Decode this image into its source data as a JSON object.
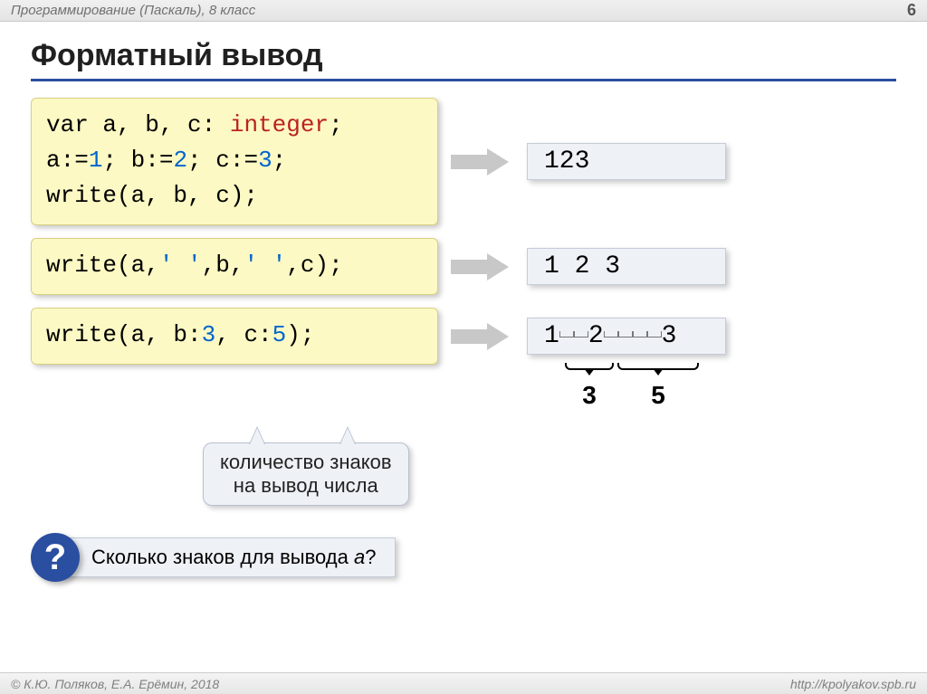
{
  "header": {
    "course": "Программирование (Паскаль), 8 класс",
    "pageNumber": "6"
  },
  "title": "Форматный вывод",
  "block1": {
    "line1": {
      "pre": "var a, b, c: ",
      "type": "integer",
      "post": ";"
    },
    "line2": {
      "p1": "a:=",
      "n1": "1",
      "p2": "; b:=",
      "n2": "2",
      "p3": "; c:=",
      "n3": "3",
      "p4": ";"
    },
    "line3": "write(a, b, c);",
    "output": "123"
  },
  "block2": {
    "code": {
      "p1": "write(a,",
      "s1": "' '",
      "p2": ",b,",
      "s2": "' '",
      "p3": ",c);"
    },
    "output": "1 2 3"
  },
  "block3": {
    "code": {
      "p1": "write(a, b:",
      "n1": "3",
      "p2": ", c:",
      "n2": "5",
      "p3": ");"
    },
    "output_segments": {
      "a": "1",
      "b": "2",
      "c": "3"
    },
    "brace1_label": "3",
    "brace2_label": "5"
  },
  "callout": {
    "line1": "количество знаков",
    "line2": "на вывод числа"
  },
  "question": {
    "mark": "?",
    "text_pre": "Сколько знаков для вывода ",
    "var": "a",
    "text_post": "?"
  },
  "footer": {
    "left": "© К.Ю. Поляков, Е.А. Ерёмин, 2018",
    "right": "http://kpolyakov.spb.ru"
  }
}
